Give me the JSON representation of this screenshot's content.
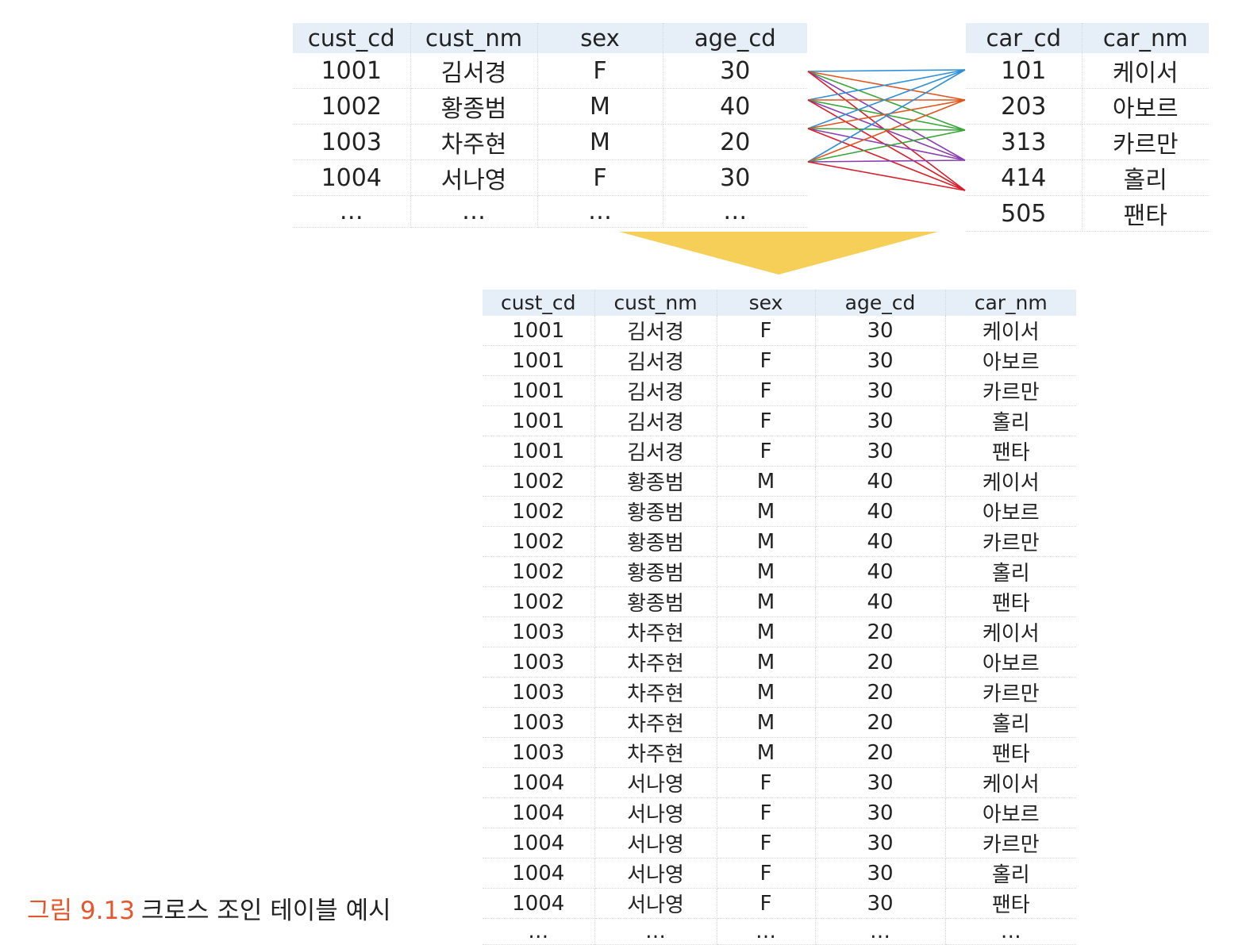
{
  "customer_table": {
    "headers": [
      "cust_cd",
      "cust_nm",
      "sex",
      "age_cd"
    ],
    "rows": [
      [
        "1001",
        "김서경",
        "F",
        "30"
      ],
      [
        "1002",
        "황종범",
        "M",
        "40"
      ],
      [
        "1003",
        "차주현",
        "M",
        "20"
      ],
      [
        "1004",
        "서나영",
        "F",
        "30"
      ],
      [
        "…",
        "…",
        "…",
        "…"
      ]
    ]
  },
  "car_table": {
    "headers": [
      "car_cd",
      "car_nm"
    ],
    "rows": [
      [
        "101",
        "케이서"
      ],
      [
        "203",
        "아보르"
      ],
      [
        "313",
        "카르만"
      ],
      [
        "414",
        "홀리"
      ],
      [
        "505",
        "팬타"
      ]
    ]
  },
  "result_table": {
    "headers": [
      "cust_cd",
      "cust_nm",
      "sex",
      "age_cd",
      "car_nm"
    ],
    "rows": [
      [
        "1001",
        "김서경",
        "F",
        "30",
        "케이서"
      ],
      [
        "1001",
        "김서경",
        "F",
        "30",
        "아보르"
      ],
      [
        "1001",
        "김서경",
        "F",
        "30",
        "카르만"
      ],
      [
        "1001",
        "김서경",
        "F",
        "30",
        "홀리"
      ],
      [
        "1001",
        "김서경",
        "F",
        "30",
        "팬타"
      ],
      [
        "1002",
        "황종범",
        "M",
        "40",
        "케이서"
      ],
      [
        "1002",
        "황종범",
        "M",
        "40",
        "아보르"
      ],
      [
        "1002",
        "황종범",
        "M",
        "40",
        "카르만"
      ],
      [
        "1002",
        "황종범",
        "M",
        "40",
        "홀리"
      ],
      [
        "1002",
        "황종범",
        "M",
        "40",
        "팬타"
      ],
      [
        "1003",
        "차주현",
        "M",
        "20",
        "케이서"
      ],
      [
        "1003",
        "차주현",
        "M",
        "20",
        "아보르"
      ],
      [
        "1003",
        "차주현",
        "M",
        "20",
        "카르만"
      ],
      [
        "1003",
        "차주현",
        "M",
        "20",
        "홀리"
      ],
      [
        "1003",
        "차주현",
        "M",
        "20",
        "팬타"
      ],
      [
        "1004",
        "서나영",
        "F",
        "30",
        "케이서"
      ],
      [
        "1004",
        "서나영",
        "F",
        "30",
        "아보르"
      ],
      [
        "1004",
        "서나영",
        "F",
        "30",
        "카르만"
      ],
      [
        "1004",
        "서나영",
        "F",
        "30",
        "홀리"
      ],
      [
        "1004",
        "서나영",
        "F",
        "30",
        "팬타"
      ],
      [
        "…",
        "…",
        "…",
        "…",
        "…"
      ]
    ]
  },
  "connector_colors": [
    "#2f8fd8",
    "#e0561f",
    "#3aa63a",
    "#8b3fb0",
    "#d81f2a"
  ],
  "arrow_color": "#f5cf58",
  "caption": {
    "figure": "그림 9.13",
    "text": "크로스 조인 테이블 예시",
    "figure_color": "#e4572e"
  }
}
